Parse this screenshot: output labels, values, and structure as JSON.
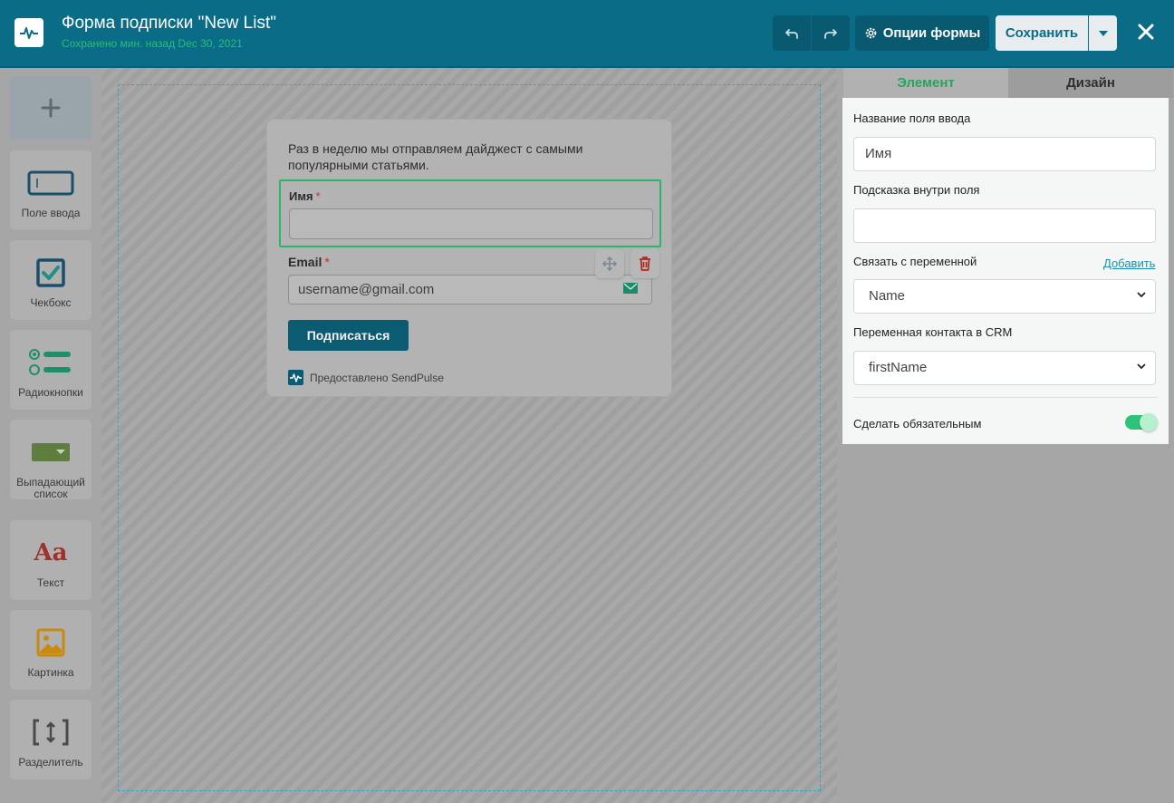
{
  "header": {
    "title": "Форма подписки \"New List\"",
    "subtitle": "Сохранено мин. назад Dec 30, 2021",
    "options_label": "Опции формы",
    "save_label": "Сохранить"
  },
  "palette": {
    "items": [
      {
        "label": "Поле ввода",
        "icon": "input-field-icon"
      },
      {
        "label": "Чекбокс",
        "icon": "checkbox-icon"
      },
      {
        "label": "Радиокнопки",
        "icon": "radio-buttons-icon"
      },
      {
        "label": "Выпадающий список",
        "icon": "dropdown-icon"
      },
      {
        "label": "Текст",
        "icon": "text-icon",
        "glyph": "Aa"
      },
      {
        "label": "Картинка",
        "icon": "image-icon"
      },
      {
        "label": "Разделитель",
        "icon": "divider-icon"
      }
    ]
  },
  "form": {
    "description": "Раз в неделю мы отправляем дайджест с самыми популярными статьями.",
    "name_label": "Имя",
    "email_label": "Email",
    "required_mark": "*",
    "email_placeholder": "username@gmail.com",
    "subscribe_label": "Подписаться",
    "powered_by": "Предоставлено SendPulse"
  },
  "panel": {
    "tabs": [
      "Элемент",
      "Дизайн"
    ],
    "field_name_label": "Название поля ввода",
    "field_name_value": "Имя",
    "placeholder_label": "Подсказка внутри поля",
    "placeholder_value": "",
    "variable_label": "Связать с переменной",
    "add_link": "Добавить",
    "variable_value": "Name",
    "crm_label": "Переменная контакта в CRM",
    "crm_value": "firstName",
    "required_label": "Сделать обязательным",
    "required_on": true
  },
  "colors": {
    "header": "#0b6c87",
    "accent_green": "#2cb56a",
    "link": "#1a8fb0",
    "danger": "#c0392b"
  }
}
